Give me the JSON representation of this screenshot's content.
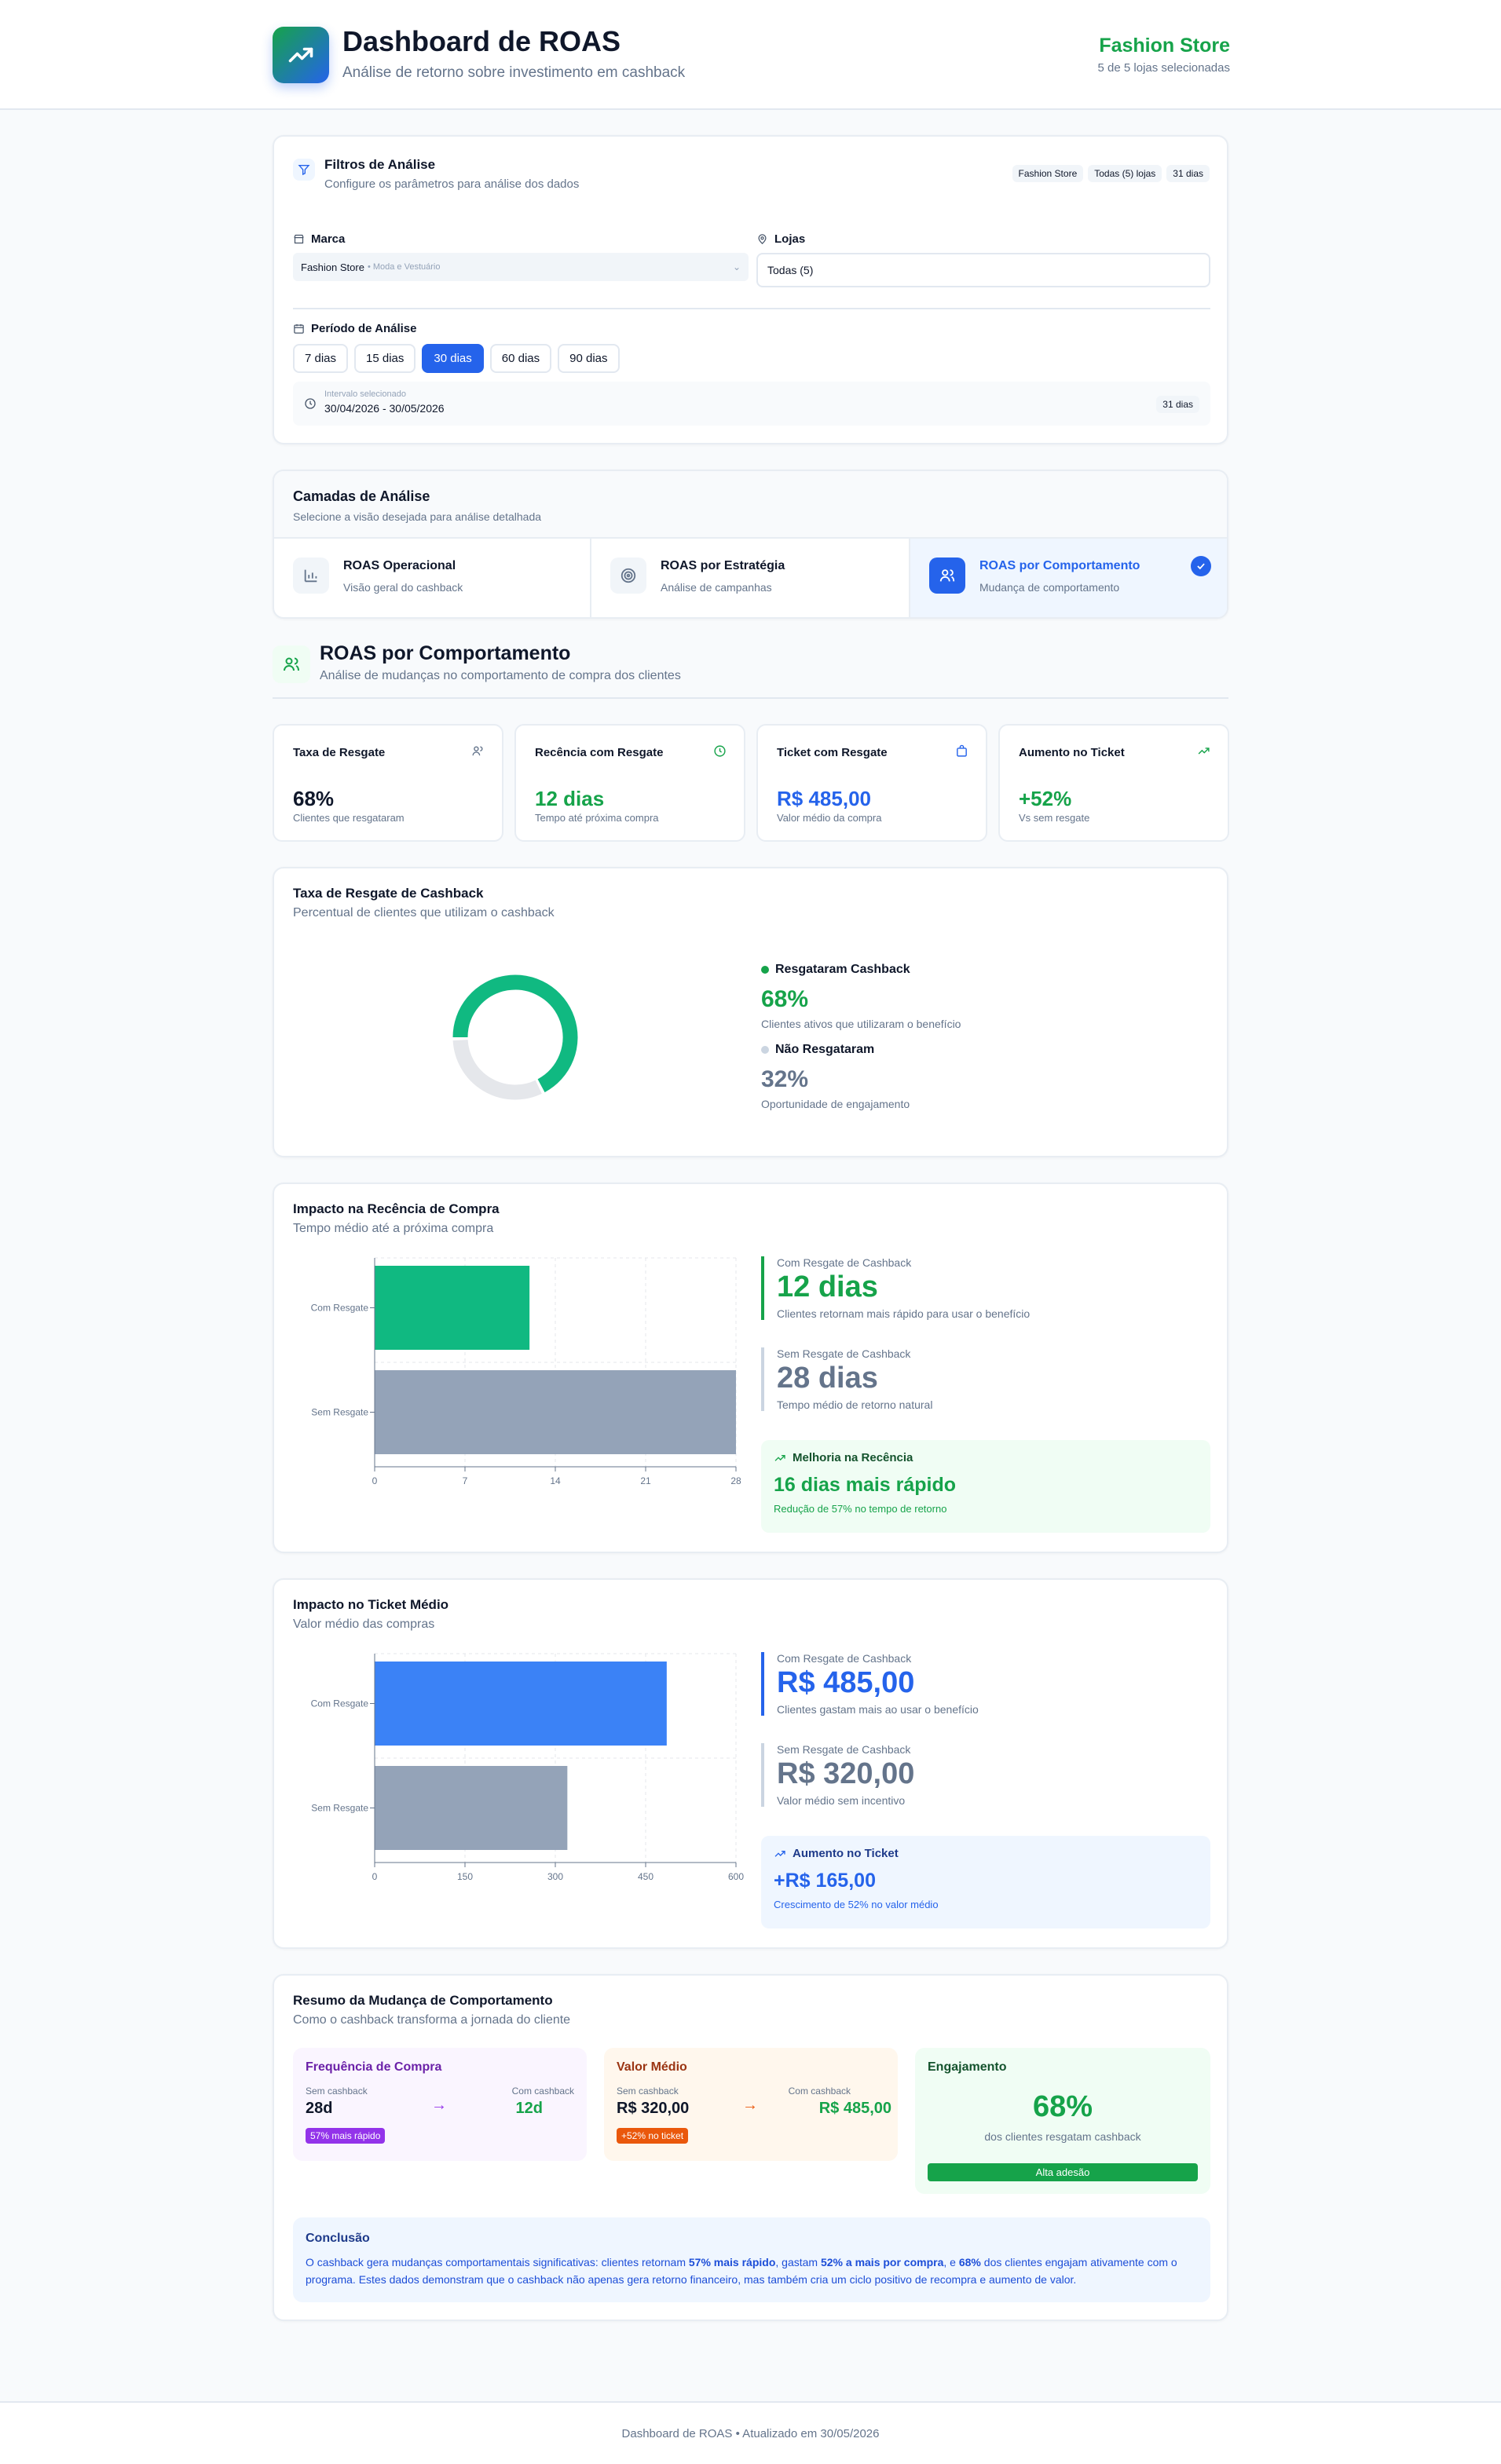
{
  "header": {
    "title": "Dashboard de ROAS",
    "subtitle": "Análise de retorno sobre investimento em cashback",
    "store": "Fashion Store",
    "store_sub": "5 de 5 lojas selecionadas"
  },
  "filters": {
    "title": "Filtros de Análise",
    "subtitle": "Configure os parâmetros para análise dos dados",
    "tags": [
      "Fashion Store",
      "Todas (5) lojas",
      "31 dias"
    ],
    "brand_label": "Marca",
    "brand_value": "Fashion Store",
    "brand_meta": "• Moda e Vestuário",
    "stores_label": "Lojas",
    "stores_value": "Todas (5)",
    "period_label": "Período de Análise",
    "periods": [
      "7 dias",
      "15 dias",
      "30 dias",
      "60 dias",
      "90 dias"
    ],
    "interval_label": "Intervalo selecionado",
    "interval_value": "30/04/2026 - 30/05/2026",
    "interval_days": "31 dias"
  },
  "layers": {
    "title": "Camadas de Análise",
    "subtitle": "Selecione a visão desejada para análise detalhada",
    "items": [
      {
        "label": "ROAS Operacional",
        "sub": "Visão geral do cashback"
      },
      {
        "label": "ROAS por Estratégia",
        "sub": "Análise de campanhas"
      },
      {
        "label": "ROAS por Comportamento",
        "sub": "Mudança de comportamento"
      }
    ]
  },
  "section": {
    "title": "ROAS por Comportamento",
    "subtitle": "Análise de mudanças no comportamento de compra dos clientes"
  },
  "kpis": [
    {
      "title": "Taxa de Resgate",
      "value": "68%",
      "sub": "Clientes que resgataram"
    },
    {
      "title": "Recência com Resgate",
      "value": "12 dias",
      "sub": "Tempo até próxima compra"
    },
    {
      "title": "Ticket com Resgate",
      "value": "R$ 485,00",
      "sub": "Valor médio da compra"
    },
    {
      "title": "Aumento no Ticket",
      "value": "+52%",
      "sub": "Vs sem resgate"
    }
  ],
  "colors": {
    "green": "#16a34a",
    "blue": "#2563eb",
    "slate": "#94a3b8",
    "teal": "#10b981"
  },
  "redemption": {
    "title": "Taxa de Resgate de Cashback",
    "subtitle": "Percentual de clientes que utilizam o cashback",
    "yes_label": "Resgataram Cashback",
    "yes_value": "68%",
    "yes_desc": "Clientes ativos que utilizaram o benefício",
    "no_label": "Não Resgataram",
    "no_value": "32%",
    "no_desc": "Oportunidade de engajamento"
  },
  "recency": {
    "title": "Impacto na Recência de Compra",
    "subtitle": "Tempo médio até a próxima compra",
    "with_label": "Com Resgate de Cashback",
    "with_value": "12 dias",
    "with_desc": "Clientes retornam mais rápido para usar o benefício",
    "without_label": "Sem Resgate de Cashback",
    "without_value": "28 dias",
    "without_desc": "Tempo médio de retorno natural",
    "box_title": "Melhoria na Recência",
    "box_value": "16 dias mais rápido",
    "box_desc": "Redução de 57% no tempo de retorno"
  },
  "ticket": {
    "title": "Impacto no Ticket Médio",
    "subtitle": "Valor médio das compras",
    "with_label": "Com Resgate de Cashback",
    "with_value": "R$ 485,00",
    "with_desc": "Clientes gastam mais ao usar o benefício",
    "without_label": "Sem Resgate de Cashback",
    "without_value": "R$ 320,00",
    "without_desc": "Valor médio sem incentivo",
    "box_title": "Aumento no Ticket",
    "box_value": "+R$ 165,00",
    "box_desc": "Crescimento de 52% no valor médio"
  },
  "chart_data": [
    {
      "type": "pie",
      "title": "Taxa de Resgate de Cashback",
      "categories": [
        "Resgataram Cashback",
        "Não Resgataram"
      ],
      "values": [
        68,
        32
      ]
    },
    {
      "type": "bar",
      "orientation": "horizontal",
      "title": "Impacto na Recência de Compra",
      "categories": [
        "Com Resgate",
        "Sem Resgate"
      ],
      "values": [
        12,
        28
      ],
      "xticks": [
        "0",
        "7",
        "14",
        "21",
        "28"
      ],
      "xlim": [
        0,
        28
      ],
      "grid": true
    },
    {
      "type": "bar",
      "orientation": "horizontal",
      "title": "Impacto no Ticket Médio",
      "categories": [
        "Com Resgate",
        "Sem Resgate"
      ],
      "values": [
        485,
        320
      ],
      "xticks": [
        "0",
        "150",
        "300",
        "450",
        "600"
      ],
      "xlim": [
        0,
        600
      ],
      "grid": true
    }
  ],
  "summary": {
    "title": "Resumo da Mudança de Comportamento",
    "subtitle": "Como o cashback transforma a jornada do cliente",
    "freq": {
      "title": "Frequência de Compra",
      "l1": "Sem cashback",
      "v1": "28d",
      "l2": "Com cashback",
      "v2": "12d",
      "badge": "57% mais rápido"
    },
    "avg": {
      "title": "Valor Médio",
      "l1": "Sem cashback",
      "v1": "R$ 320,00",
      "l2": "Com cashback",
      "v2": "R$ 485,00",
      "badge": "+52% no ticket"
    },
    "eng": {
      "title": "Engajamento",
      "value": "68%",
      "desc": "dos clientes resgatam cashback",
      "badge": "Alta adesão"
    },
    "conclusion_title": "Conclusão",
    "c1": "O cashback gera mudanças comportamentais significativas: clientes retornam ",
    "b1": "57% mais rápido",
    "c2": ", gastam ",
    "b2": "52% a mais por compra",
    "c3": ", e ",
    "b3": "68%",
    "c4": " dos clientes engajam ativamente com o programa. Estes dados demonstram que o cashback não apenas gera retorno financeiro, mas também cria um ciclo positivo de recompra e aumento de valor."
  },
  "footer": "Dashboard de ROAS • Atualizado em 30/05/2026"
}
